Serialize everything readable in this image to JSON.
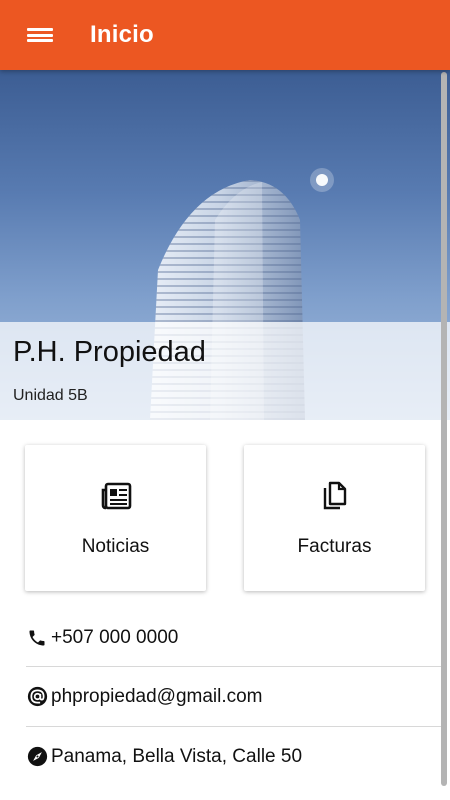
{
  "appbar": {
    "title": "Inicio",
    "menu_icon": "menu-icon"
  },
  "hero": {
    "title": "P.H. Propiedad",
    "subtitle": "Unidad 5B"
  },
  "cards": [
    {
      "label": "Noticias",
      "icon": "newspaper-icon"
    },
    {
      "label": "Facturas",
      "icon": "documents-icon"
    }
  ],
  "contact": {
    "phone": "+507 000 0000",
    "email": "phpropiedad@gmail.com",
    "address": "Panama, Bella Vista, Calle 50"
  },
  "colors": {
    "appbar": "#ec5722",
    "text": "#111111",
    "divider": "#d8d8d8"
  }
}
